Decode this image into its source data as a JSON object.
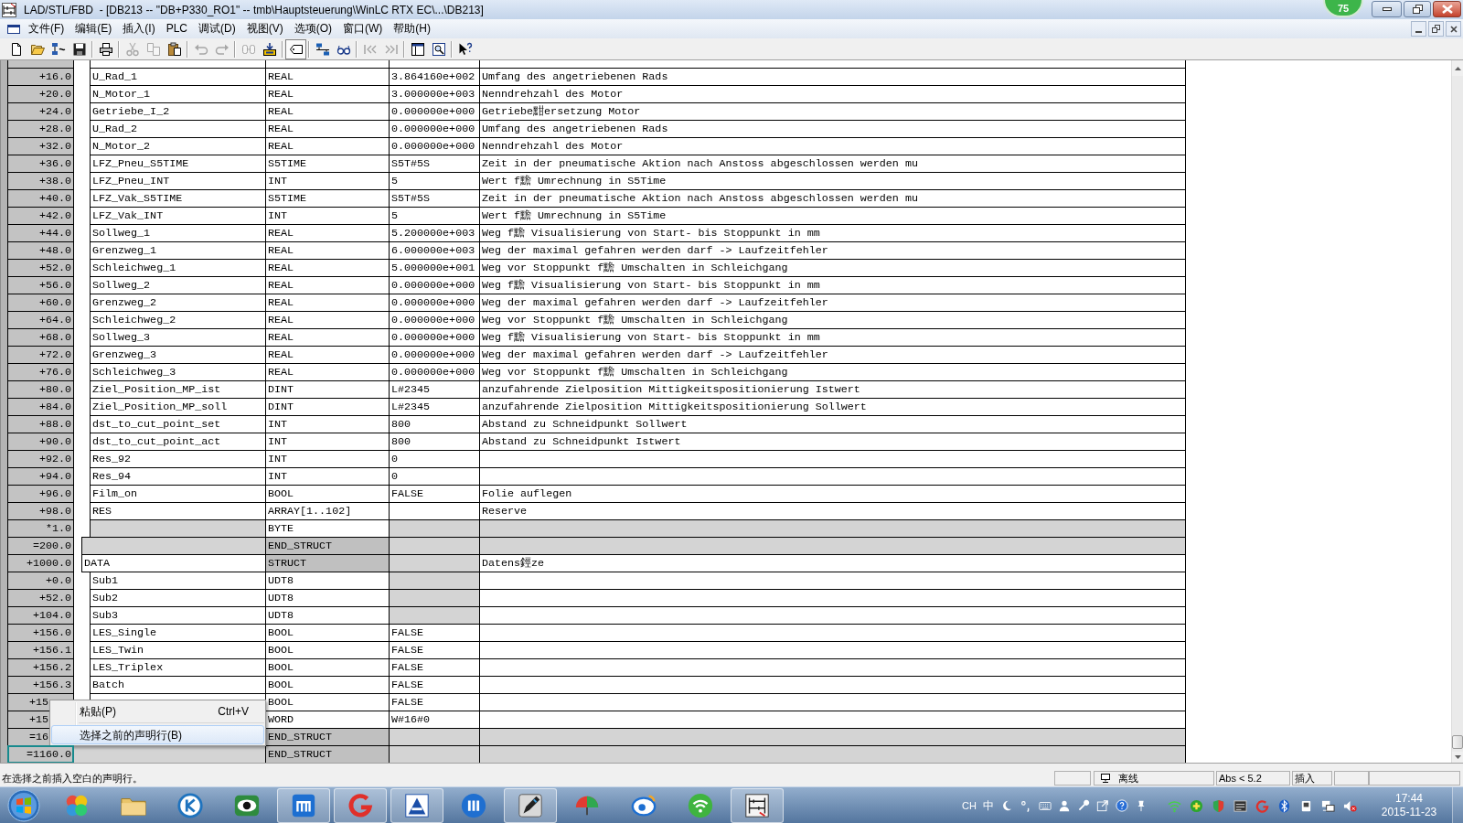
{
  "window": {
    "title": "LAD/STL/FBD  - [DB213 -- \"DB+P330_RO1\" -- tmb\\Hauptsteuerung\\WinLC RTX EC\\...\\DB213]",
    "badge": "75"
  },
  "menu_bar": [
    "文件(F)",
    "编辑(E)",
    "插入(I)",
    "PLC",
    "调试(D)",
    "视图(V)",
    "选项(O)",
    "窗口(W)",
    "帮助(H)"
  ],
  "toolbar": {
    "groups": [
      [
        {
          "disabled": false,
          "pressed": false
        },
        {
          "disabled": false,
          "pressed": false
        },
        {
          "disabled": false,
          "pressed": false
        },
        {
          "disabled": false,
          "pressed": false
        }
      ],
      [
        {
          "disabled": false,
          "pressed": false
        }
      ],
      [
        {
          "disabled": true,
          "pressed": false
        },
        {
          "disabled": true,
          "pressed": false
        },
        {
          "disabled": false,
          "pressed": false
        }
      ],
      [
        {
          "disabled": true,
          "pressed": false
        },
        {
          "disabled": true,
          "pressed": false
        }
      ],
      [
        {
          "disabled": true,
          "pressed": false
        },
        {
          "disabled": false,
          "pressed": false
        }
      ],
      [
        {
          "disabled": false,
          "pressed": true
        }
      ],
      [
        {
          "disabled": false,
          "pressed": false
        },
        {
          "disabled": false,
          "pressed": false
        }
      ],
      [
        {
          "disabled": true,
          "pressed": false
        },
        {
          "disabled": true,
          "pressed": false
        }
      ],
      [
        {
          "disabled": false,
          "pressed": false
        },
        {
          "disabled": false,
          "pressed": false
        }
      ],
      [
        {
          "disabled": false,
          "pressed": false
        }
      ]
    ]
  },
  "table": {
    "rows": [
      {
        "kind": "group",
        "children": [
          {
            "kind": "group",
            "children": [
              {
                "kind": "var",
                "address": "+16.0",
                "name": "U_Rad_1",
                "type": "REAL",
                "initial_value": "3.864160e+002",
                "comment": "Umfang des angetriebenen Rads",
                "selected": false
              },
              {
                "kind": "var",
                "address": "+20.0",
                "name": "N_Motor_1",
                "type": "REAL",
                "initial_value": "3.000000e+003",
                "comment": "Nenndrehzahl des Motor",
                "selected": false
              },
              {
                "kind": "var",
                "address": "+24.0",
                "name": "Getriebe_I_2",
                "type": "REAL",
                "initial_value": "0.000000e+000",
                "comment": "Getriebe黚ersetzung Motor",
                "selected": false
              },
              {
                "kind": "var",
                "address": "+28.0",
                "name": "U_Rad_2",
                "type": "REAL",
                "initial_value": "0.000000e+000",
                "comment": "Umfang des angetriebenen Rads",
                "selected": false
              },
              {
                "kind": "var",
                "address": "+32.0",
                "name": "N_Motor_2",
                "type": "REAL",
                "initial_value": "0.000000e+000",
                "comment": "Nenndrehzahl des Motor",
                "selected": false
              },
              {
                "kind": "var",
                "address": "+36.0",
                "name": "LFZ_Pneu_S5TIME",
                "type": "S5TIME",
                "initial_value": "S5T#5S",
                "comment": "Zeit in der pneumatische Aktion nach Anstoss abgeschlossen werden mu",
                "selected": false
              },
              {
                "kind": "var",
                "address": "+38.0",
                "name": "LFZ_Pneu_INT",
                "type": "INT",
                "initial_value": "5",
                "comment": "Wert f黵 Umrechnung in S5Time",
                "selected": false
              },
              {
                "kind": "var",
                "address": "+40.0",
                "name": "LFZ_Vak_S5TIME",
                "type": "S5TIME",
                "initial_value": "S5T#5S",
                "comment": "Zeit in der pneumatische Aktion nach Anstoss abgeschlossen werden mu",
                "selected": false
              },
              {
                "kind": "var",
                "address": "+42.0",
                "name": "LFZ_Vak_INT",
                "type": "INT",
                "initial_value": "5",
                "comment": "Wert f黵 Umrechnung in S5Time",
                "selected": false
              },
              {
                "kind": "var",
                "address": "+44.0",
                "name": "Sollweg_1",
                "type": "REAL",
                "initial_value": "5.200000e+003",
                "comment": "Weg f黵 Visualisierung von Start- bis Stoppunkt in mm",
                "selected": false
              },
              {
                "kind": "var",
                "address": "+48.0",
                "name": "Grenzweg_1",
                "type": "REAL",
                "initial_value": "6.000000e+003",
                "comment": "Weg der maximal gefahren werden darf -> Laufzeitfehler",
                "selected": false
              },
              {
                "kind": "var",
                "address": "+52.0",
                "name": "Schleichweg_1",
                "type": "REAL",
                "initial_value": "5.000000e+001",
                "comment": "Weg vor Stoppunkt f黵 Umschalten in Schleichgang",
                "selected": false
              },
              {
                "kind": "var",
                "address": "+56.0",
                "name": "Sollweg_2",
                "type": "REAL",
                "initial_value": "0.000000e+000",
                "comment": "Weg f黵 Visualisierung von Start- bis Stoppunkt in mm",
                "selected": false
              },
              {
                "kind": "var",
                "address": "+60.0",
                "name": "Grenzweg_2",
                "type": "REAL",
                "initial_value": "0.000000e+000",
                "comment": "Weg der maximal gefahren werden darf -> Laufzeitfehler",
                "selected": false
              },
              {
                "kind": "var",
                "address": "+64.0",
                "name": "Schleichweg_2",
                "type": "REAL",
                "initial_value": "0.000000e+000",
                "comment": "Weg vor Stoppunkt f黵 Umschalten in Schleichgang",
                "selected": false
              },
              {
                "kind": "var",
                "address": "+68.0",
                "name": "Sollweg_3",
                "type": "REAL",
                "initial_value": "0.000000e+000",
                "comment": "Weg f黵 Visualisierung von Start- bis Stoppunkt in mm",
                "selected": false
              },
              {
                "kind": "var",
                "address": "+72.0",
                "name": "Grenzweg_3",
                "type": "REAL",
                "initial_value": "0.000000e+000",
                "comment": "Weg der maximal gefahren werden darf -> Laufzeitfehler",
                "selected": false
              },
              {
                "kind": "var",
                "address": "+76.0",
                "name": "Schleichweg_3",
                "type": "REAL",
                "initial_value": "0.000000e+000",
                "comment": "Weg vor Stoppunkt f黵 Umschalten in Schleichgang",
                "selected": false
              },
              {
                "kind": "var",
                "address": "+80.0",
                "name": "Ziel_Position_MP_ist",
                "type": "DINT",
                "initial_value": "L#2345",
                "comment": "anzufahrende Zielposition Mittigkeitspositionierung Istwert",
                "selected": false
              },
              {
                "kind": "var",
                "address": "+84.0",
                "name": "Ziel_Position_MP_soll",
                "type": "DINT",
                "initial_value": "L#2345",
                "comment": "anzufahrende Zielposition Mittigkeitspositionierung Sollwert",
                "selected": false
              },
              {
                "kind": "var",
                "address": "+88.0",
                "name": "dst_to_cut_point_set",
                "type": "INT",
                "initial_value": "800",
                "comment": "Abstand zu Schneidpunkt Sollwert",
                "selected": false
              },
              {
                "kind": "var",
                "address": "+90.0",
                "name": "dst_to_cut_point_act",
                "type": "INT",
                "initial_value": "800",
                "comment": "Abstand zu Schneidpunkt Istwert",
                "selected": false
              },
              {
                "kind": "var",
                "address": "+92.0",
                "name": "Res_92",
                "type": "INT",
                "initial_value": "0",
                "selected": false
              },
              {
                "kind": "var",
                "address": "+94.0",
                "name": "Res_94",
                "type": "INT",
                "initial_value": "0",
                "selected": false
              },
              {
                "kind": "var",
                "address": "+96.0",
                "name": "Film_on",
                "type": "BOOL",
                "initial_value": "FALSE",
                "comment": "Folie auflegen",
                "selected": false
              },
              {
                "kind": "array",
                "address": "+98.0",
                "name": "RES",
                "type": "ARRAY[1..102]",
                "comment": "Reserve",
                "selected": false
              },
              {
                "kind": "element",
                "address": "*1.0",
                "type": "BYTE",
                "selected": false
              }
            ]
          },
          {
            "kind": "end",
            "address": "=200.0",
            "type": "END_STRUCT",
            "selected": false
          },
          {
            "kind": "struct",
            "address": "+1000.0",
            "name": "DATA",
            "type": "STRUCT",
            "comment": "Datens鋞ze",
            "selected": false,
            "children": [
              {
                "kind": "udt",
                "address": "+0.0",
                "name": "Sub1",
                "type": "UDT8",
                "selected": false
              },
              {
                "kind": "udt",
                "address": "+52.0",
                "name": "Sub2",
                "type": "UDT8",
                "selected": false
              },
              {
                "kind": "udt",
                "address": "+104.0",
                "name": "Sub3",
                "type": "UDT8",
                "selected": false
              },
              {
                "kind": "var",
                "address": "+156.0",
                "name": "LES_Single",
                "type": "BOOL",
                "initial_value": "FALSE",
                "selected": false
              },
              {
                "kind": "var",
                "address": "+156.1",
                "name": "LES_Twin",
                "type": "BOOL",
                "initial_value": "FALSE",
                "selected": false
              },
              {
                "kind": "var",
                "address": "+156.2",
                "name": "LES_Triplex",
                "type": "BOOL",
                "initial_value": "FALSE",
                "selected": false
              },
              {
                "kind": "var",
                "address": "+156.3",
                "name": "Batch",
                "type": "BOOL",
                "initial_value": "FALSE",
                "selected": false
              },
              {
                "kind": "var",
                "address": "+15",
                "type": "BOOL",
                "initial_value": "FALSE",
                "selected": false
              },
              {
                "kind": "var",
                "address": "+15",
                "type": "WORD",
                "initial_value": "W#16#0",
                "selected": false
              }
            ]
          },
          {
            "kind": "end",
            "address": "=16",
            "type": "END_STRUCT",
            "selected": false
          }
        ]
      },
      {
        "kind": "end",
        "address": "=1160.0",
        "type": "END_STRUCT",
        "selected": true
      }
    ]
  },
  "context_menu": {
    "items": [
      {
        "kind": "item",
        "label": "粘贴(P)",
        "shortcut": "Ctrl+V",
        "selected": false
      },
      {
        "kind": "separator"
      },
      {
        "kind": "item",
        "label": "选择之前的声明行(B)",
        "selected": true
      }
    ]
  },
  "status_bar": {
    "message": "在选择之前插入空白的声明行。",
    "connection": "离线",
    "position": "Abs < 5.2",
    "mode": "插入"
  },
  "taskbar": {
    "apps": [
      {
        "running": false
      },
      {
        "running": false
      },
      {
        "running": false
      },
      {
        "running": false
      },
      {
        "running": true
      },
      {
        "running": true
      },
      {
        "running": true
      },
      {
        "running": false
      },
      {
        "running": true
      },
      {
        "running": false
      },
      {
        "running": false
      },
      {
        "running": false
      },
      {
        "running": true
      }
    ],
    "language": "CH",
    "input_mode": "中",
    "time": "17:44",
    "date": "2015-11-23"
  }
}
